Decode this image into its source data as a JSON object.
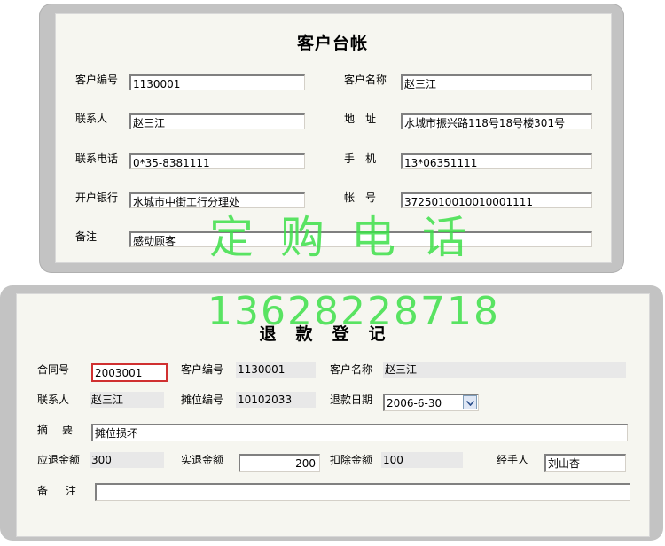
{
  "customer_ledger": {
    "title": "客户台帐",
    "fields": {
      "customer_no": {
        "label": "客户编号",
        "value": "1130001"
      },
      "customer_name": {
        "label": "客户名称",
        "value": "赵三江"
      },
      "contact": {
        "label": "联系人",
        "value": "赵三江"
      },
      "address": {
        "label": "地　址",
        "value": "水城市振兴路118号18号楼301号"
      },
      "phone": {
        "label": "联系电话",
        "value": "0*35-8381111"
      },
      "mobile": {
        "label": "手　机",
        "value": "13*06351111"
      },
      "bank": {
        "label": "开户银行",
        "value": "水城市中街工行分理处"
      },
      "account": {
        "label": "帐　号",
        "value": "3725010010010001111"
      },
      "remark": {
        "label": "备注",
        "value": "感动顾客"
      }
    }
  },
  "refund": {
    "title": "退款登记",
    "fields": {
      "contract_no": {
        "label": "合同号",
        "value": "2003001"
      },
      "customer_no": {
        "label": "客户编号",
        "value": "1130001"
      },
      "customer_name": {
        "label": "客户名称",
        "value": "赵三江"
      },
      "contact": {
        "label": "联系人",
        "value": "赵三江"
      },
      "booth_no": {
        "label": "摊位编号",
        "value": "10102033"
      },
      "refund_date": {
        "label": "退款日期",
        "value": "2006-6-30"
      },
      "summary": {
        "label": "摘　要",
        "value": "摊位损坏"
      },
      "refund_due": {
        "label": "应退金额",
        "value": "300"
      },
      "refund_actual": {
        "label": "实退金额",
        "value": "200"
      },
      "deduction": {
        "label": "扣除金额",
        "value": "100"
      },
      "handler": {
        "label": "经手人",
        "value": "刘山杏"
      },
      "remark": {
        "label": "备　注",
        "value": ""
      }
    }
  },
  "watermark": {
    "text": "定购电话",
    "number": "13628228718",
    "color": "#3ee04a"
  },
  "icons": {
    "date_dropdown": "chevron-down-icon"
  }
}
